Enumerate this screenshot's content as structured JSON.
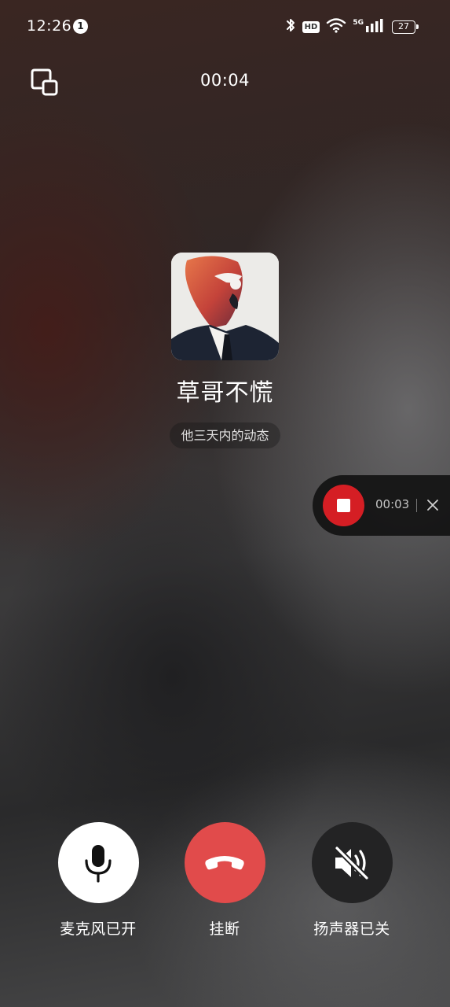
{
  "status_bar": {
    "time": "12:26",
    "notification_count": "1",
    "hd_label": "HD",
    "network_label": "5G",
    "battery_level": "27"
  },
  "call": {
    "duration": "00:04",
    "contact_name": "草哥不慌",
    "moments_label": "他三天内的动态"
  },
  "recording": {
    "duration": "00:03"
  },
  "controls": {
    "mic_label": "麦克风已开",
    "hangup_label": "挂断",
    "speaker_label": "扬声器已关"
  },
  "colors": {
    "hangup": "#e14b4b",
    "record": "#d51e24",
    "mic_bg": "#ffffff",
    "speaker_bg": "#232324"
  },
  "icons": {
    "minimize": "float-window-icon",
    "mic": "microphone-icon",
    "hangup": "hang-up-phone-icon",
    "speaker": "speaker-muted-icon",
    "record_stop": "stop-record-icon",
    "record_close": "close-icon"
  }
}
